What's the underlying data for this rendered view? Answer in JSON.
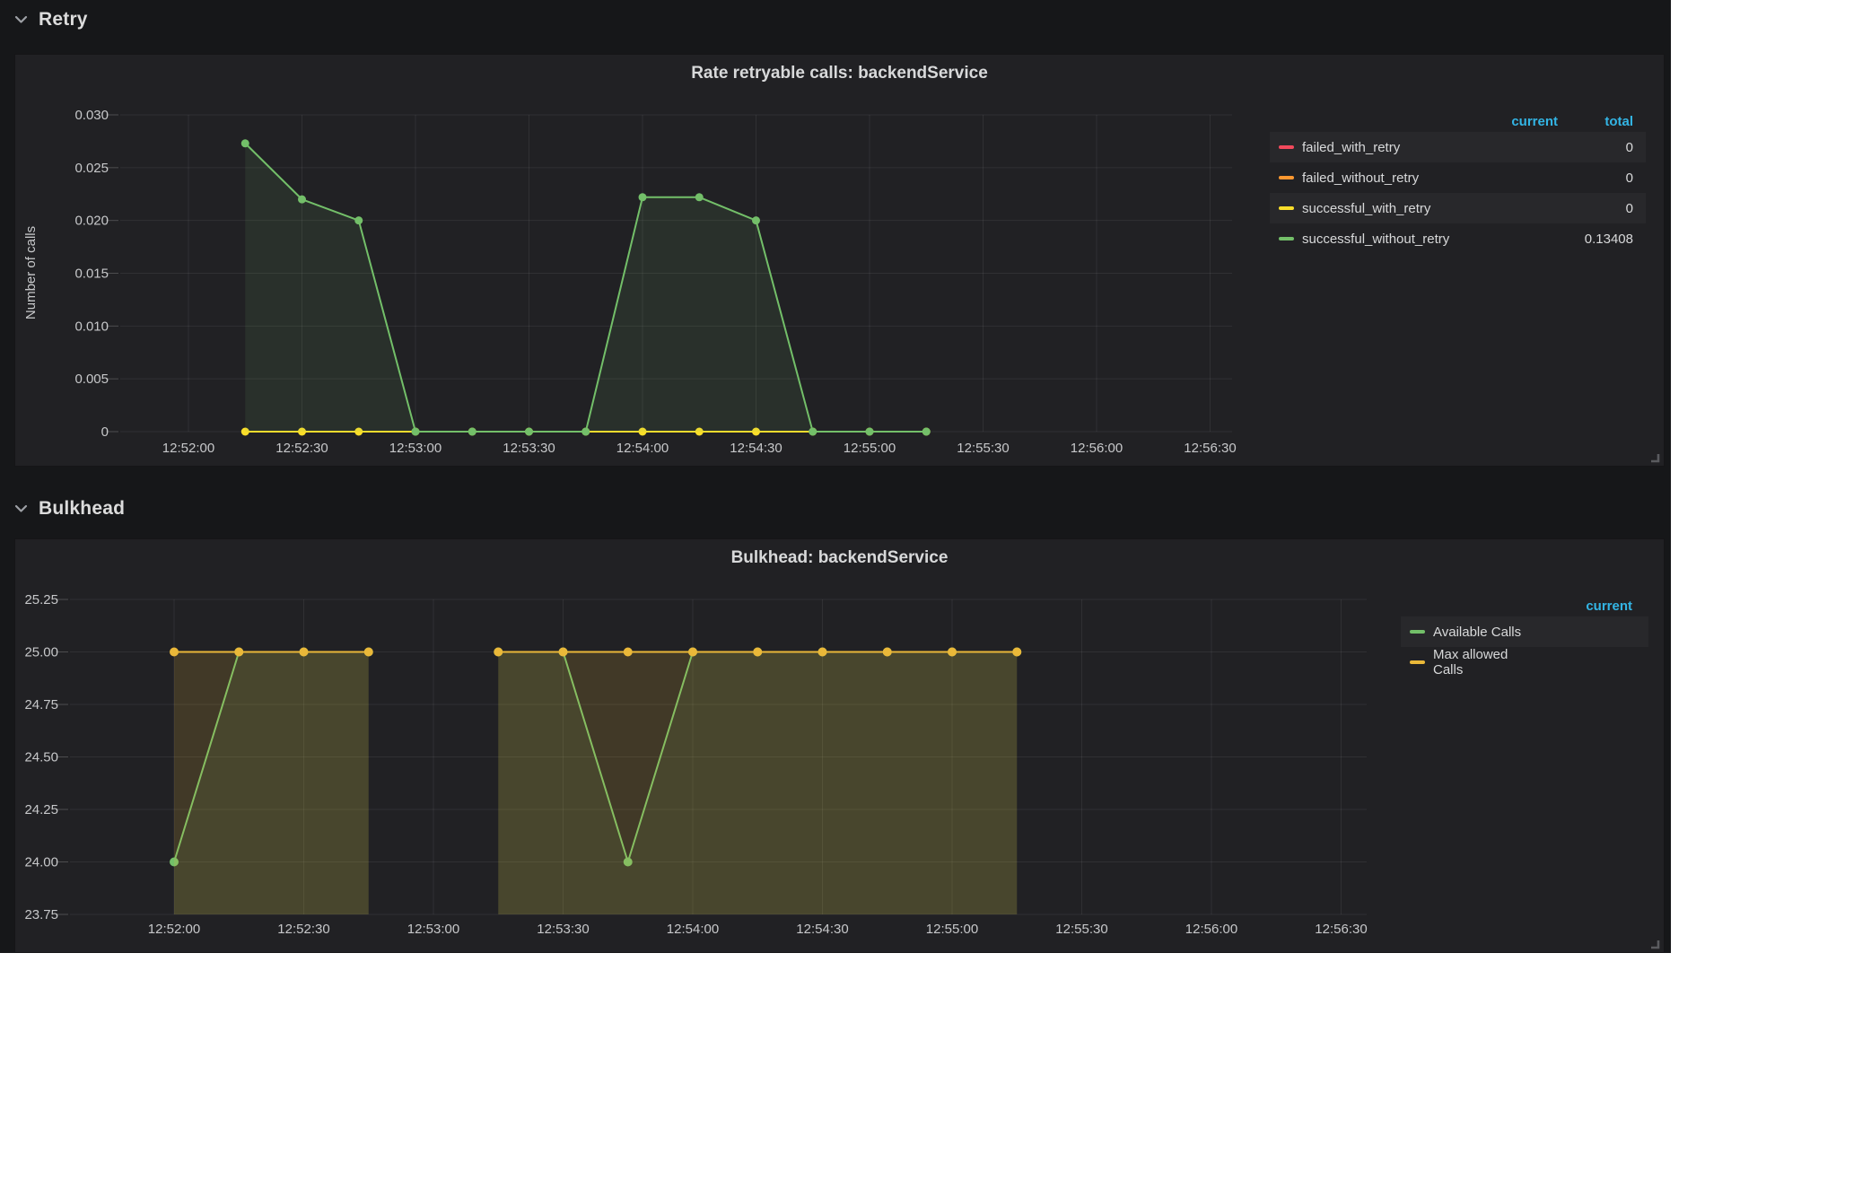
{
  "dashboard": {
    "bg": "#161719",
    "panel_bg": "#212124",
    "accent": "#33b5e5",
    "sections": [
      {
        "label": "Retry"
      },
      {
        "label": "Bulkhead"
      }
    ]
  },
  "chart_data": [
    {
      "type": "line",
      "title": "Rate retryable calls: backendService",
      "ylabel": "Number of calls",
      "ylim": [
        0,
        0.03
      ],
      "grid": true,
      "legend_position": "right-table",
      "y_ticks": [
        "0.030",
        "0.025",
        "0.020",
        "0.015",
        "0.010",
        "0.005",
        "0"
      ],
      "x_ticks": [
        "12:52:00",
        "12:52:30",
        "12:53:00",
        "12:53:30",
        "12:54:00",
        "12:54:30",
        "12:55:00",
        "12:55:30",
        "12:56:00",
        "12:56:30"
      ],
      "x": [
        "12:52:15",
        "12:52:30",
        "12:52:45",
        "12:53:00",
        "12:53:15",
        "12:53:30",
        "12:53:45",
        "12:54:00",
        "12:54:15",
        "12:54:30",
        "12:54:45",
        "12:55:00",
        "12:55:15"
      ],
      "legend_columns": [
        "current",
        "total"
      ],
      "series": [
        {
          "name": "failed_with_retry",
          "color": "#f2495c",
          "values": [],
          "current": "",
          "total": "0"
        },
        {
          "name": "failed_without_retry",
          "color": "#ff9830",
          "values": [],
          "current": "",
          "total": "0"
        },
        {
          "name": "successful_with_retry",
          "color": "#fade2a",
          "values": [
            0,
            0,
            0,
            0,
            0,
            0,
            0,
            0,
            0,
            0,
            0,
            0,
            0
          ],
          "current": "",
          "total": "0"
        },
        {
          "name": "successful_without_retry",
          "color": "#73bf69",
          "fill_opacity": 0.1,
          "values": [
            0.0273,
            0.022,
            0.02,
            0,
            0,
            0,
            0,
            0.0222,
            0.0222,
            0.02,
            0,
            0,
            0
          ],
          "current": "",
          "total": "0.13408"
        }
      ]
    },
    {
      "type": "line",
      "title": "Bulkhead: backendService",
      "ylabel": "",
      "ylim": [
        23.75,
        25.25
      ],
      "grid": true,
      "legend_position": "right-table",
      "y_ticks": [
        "25.25",
        "25.00",
        "24.75",
        "24.50",
        "24.25",
        "24.00",
        "23.75"
      ],
      "x_ticks": [
        "12:52:00",
        "12:52:30",
        "12:53:00",
        "12:53:30",
        "12:54:00",
        "12:54:30",
        "12:55:00",
        "12:55:30",
        "12:56:00",
        "12:56:30"
      ],
      "x": [
        "12:52:00",
        "12:52:15",
        "12:52:30",
        "12:52:45",
        "12:53:00",
        "12:53:15",
        "12:53:30",
        "12:53:45",
        "12:54:00",
        "12:54:15",
        "12:54:30",
        "12:54:45",
        "12:55:00",
        "12:55:15"
      ],
      "legend_columns": [
        "current"
      ],
      "series": [
        {
          "name": "Available Calls",
          "color": "#73bf69",
          "fill_opacity": 0.1,
          "values": [
            24,
            25,
            25,
            25,
            null,
            25,
            25,
            24,
            25,
            25,
            25,
            25,
            25,
            25
          ],
          "current": ""
        },
        {
          "name": "Max allowed Calls",
          "color": "#eab839",
          "fill_opacity": 0.16,
          "values": [
            25,
            25,
            25,
            25,
            null,
            25,
            25,
            25,
            25,
            25,
            25,
            25,
            25,
            25
          ],
          "current": ""
        }
      ]
    }
  ]
}
